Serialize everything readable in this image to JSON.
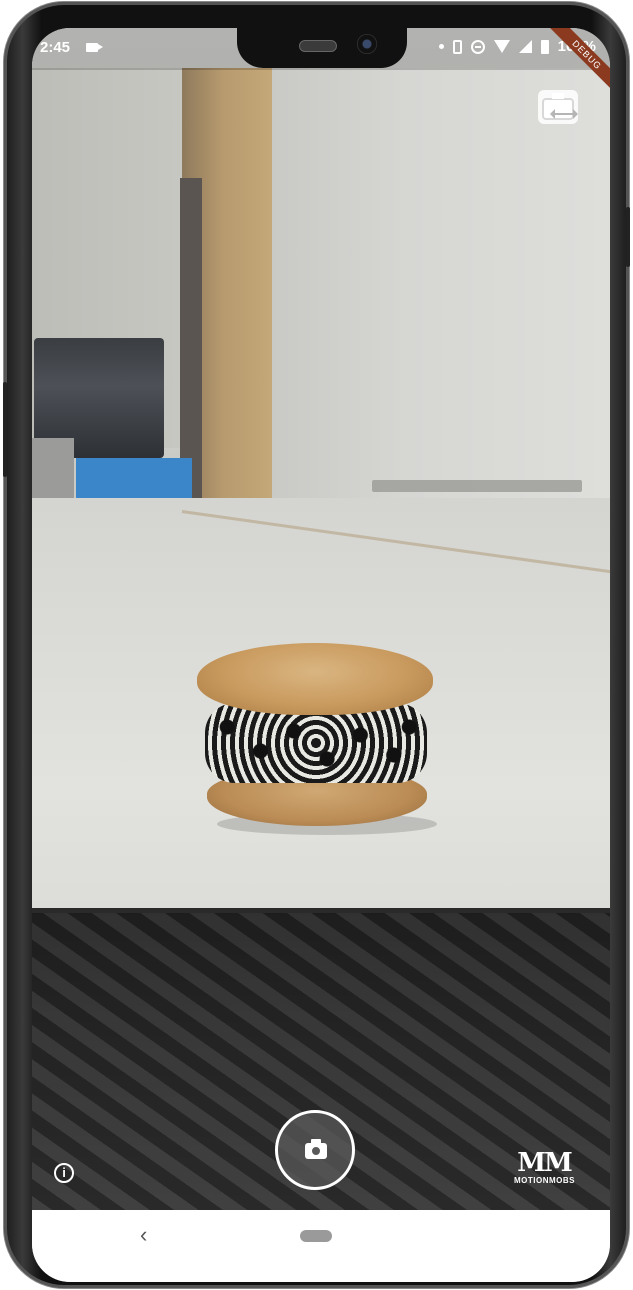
{
  "status_bar": {
    "time": "2:45",
    "battery_percent": "100%",
    "icons": [
      "recording-icon",
      "dot-icon",
      "vibrate-icon",
      "do-not-disturb-icon",
      "wifi-icon",
      "signal-icon",
      "battery-icon"
    ]
  },
  "debug_banner": {
    "label": "DEBUG"
  },
  "camera": {
    "switch_camera_icon": "switch-camera-icon",
    "shutter_icon": "camera-icon",
    "info_icon": "info-icon",
    "info_glyph": "i"
  },
  "branding": {
    "logo_mark": "MM",
    "logo_text": "MOTIONMOBS"
  },
  "nav": {
    "back_glyph": "‹"
  }
}
